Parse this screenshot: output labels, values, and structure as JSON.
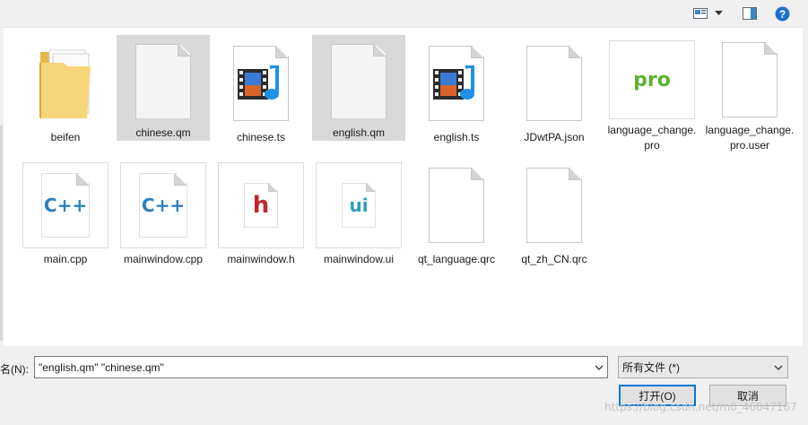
{
  "toolbar": {
    "viewmode_icon": "view-mode-icon",
    "dropdown_icon": "chevron-down-icon",
    "preview_icon": "preview-pane-icon",
    "help_icon": "help-icon",
    "help_glyph": "?"
  },
  "files": [
    {
      "name": "beifen",
      "type": "folder",
      "selected": false
    },
    {
      "name": "chinese.qm",
      "type": "blank",
      "selected": true
    },
    {
      "name": "chinese.ts",
      "type": "media",
      "selected": false
    },
    {
      "name": "english.qm",
      "type": "blank",
      "selected": true
    },
    {
      "name": "english.ts",
      "type": "media",
      "selected": false
    },
    {
      "name": "JDwtPA.json",
      "type": "blank",
      "selected": false
    },
    {
      "name": "language_change.pro",
      "type": "pro",
      "selected": false,
      "badge": "pro"
    },
    {
      "name": "language_change.pro.user",
      "type": "blank",
      "selected": false
    },
    {
      "name": "main.cpp",
      "type": "cpp",
      "selected": false,
      "badge": "C++"
    },
    {
      "name": "mainwindow.cpp",
      "type": "cpp",
      "selected": false,
      "badge": "C++"
    },
    {
      "name": "mainwindow.h",
      "type": "h",
      "selected": false,
      "badge": "h"
    },
    {
      "name": "mainwindow.ui",
      "type": "ui",
      "selected": false,
      "badge": "ui"
    },
    {
      "name": "qt_language.qrc",
      "type": "blank",
      "selected": false
    },
    {
      "name": "qt_zh_CN.qrc",
      "type": "blank",
      "selected": false
    }
  ],
  "bottom": {
    "filename_label": "名(N):",
    "filename_value": "\"english.qm\" \"chinese.qm\"",
    "filter_value": "所有文件 (*)",
    "open_label": "打开(O)",
    "cancel_label": "取消",
    "watermark": "https://blog.csdn.net/m0_46047167"
  },
  "colors": {
    "selection": "#d9d9d9",
    "accent_border": "#0078d7",
    "help_blue": "#1e6fcc",
    "pro_green": "#5cb230",
    "cpp_blue": "#2a7fc1",
    "h_red": "#c1272d",
    "ui_teal": "#2aa0b7"
  }
}
